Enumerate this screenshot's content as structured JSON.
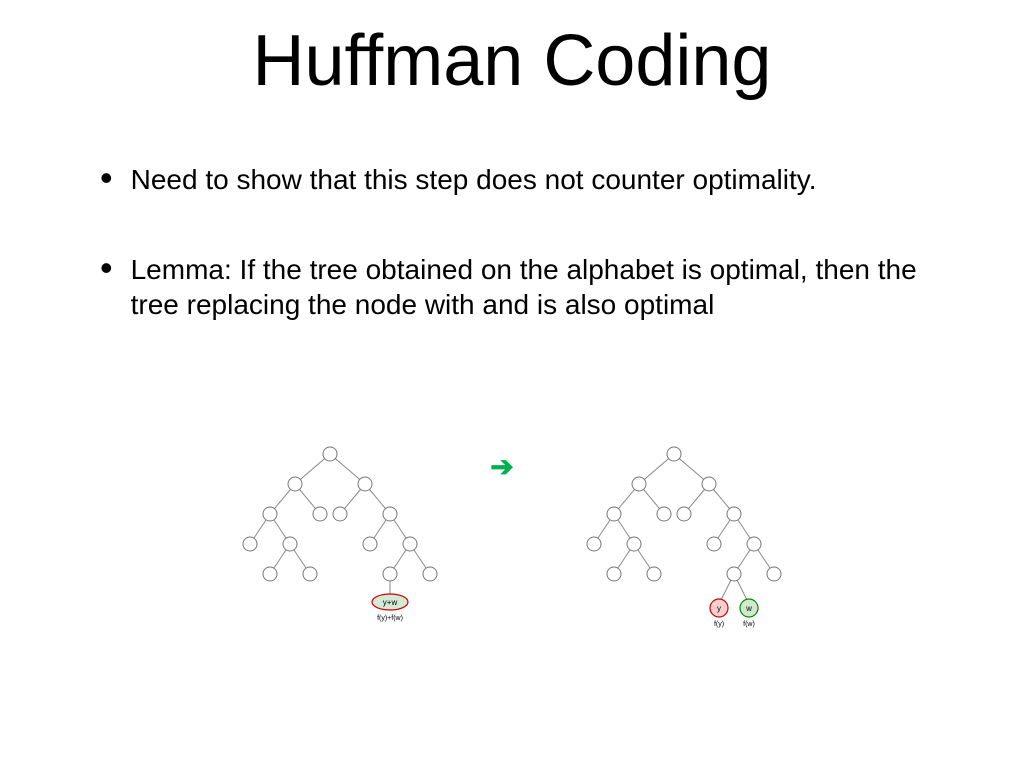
{
  "title": "Huffman Coding",
  "bullets": [
    "Need to show that this step does not counter optimality.",
    "Lemma:  If the tree  obtained on the alphabet  is optimal, then the tree  replacing the  node with  and  is also optimal"
  ],
  "diagram": {
    "arrow": "➔",
    "left_tree": {
      "merged_node_label": "y+w",
      "merged_node_sub": "f(y)+f(w)"
    },
    "right_tree": {
      "leaf_y": "y",
      "leaf_w": "w",
      "leaf_y_sub": "f(y)",
      "leaf_w_sub": "f(w)"
    },
    "colors": {
      "merged_fill": "#d5ead5",
      "merged_stroke": "#cc0000",
      "y_fill": "#f8cfcf",
      "y_stroke": "#cc0000",
      "w_fill": "#d0ead0",
      "w_stroke": "#008800",
      "node_stroke": "#777777",
      "edge": "#888888"
    }
  }
}
